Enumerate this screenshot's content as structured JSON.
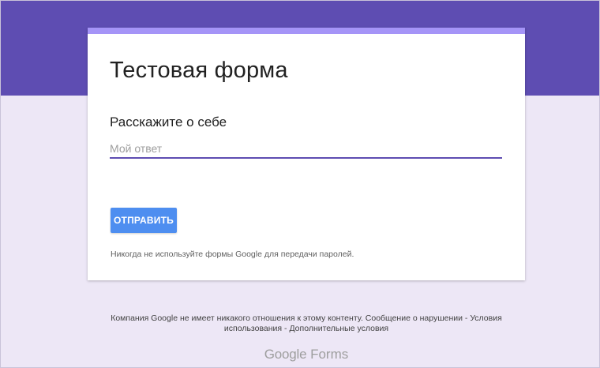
{
  "form": {
    "title": "Тестовая форма",
    "question_label": "Расскажите о себе",
    "answer_placeholder": "Мой ответ",
    "answer_value": "",
    "submit_label": "ОТПРАВИТЬ",
    "password_warning": "Никогда не используйте формы Google для передачи паролей."
  },
  "footer": {
    "text_prefix": "Компания Google не имеет никакого отношения к этому контенту.",
    "report_link": "Сообщение о нарушении",
    "separator_1": " - ",
    "terms_link": "Условия использования",
    "separator_2": " - ",
    "additional_terms_link": "Дополнительные условия"
  },
  "brand": {
    "google": "Google",
    "forms": "Forms"
  },
  "colors": {
    "header_band": "#5e4db2",
    "card_accent": "#a594f7",
    "background": "#ede7f6",
    "submit_button": "#4e8ef0",
    "input_underline": "#5e4db2"
  }
}
